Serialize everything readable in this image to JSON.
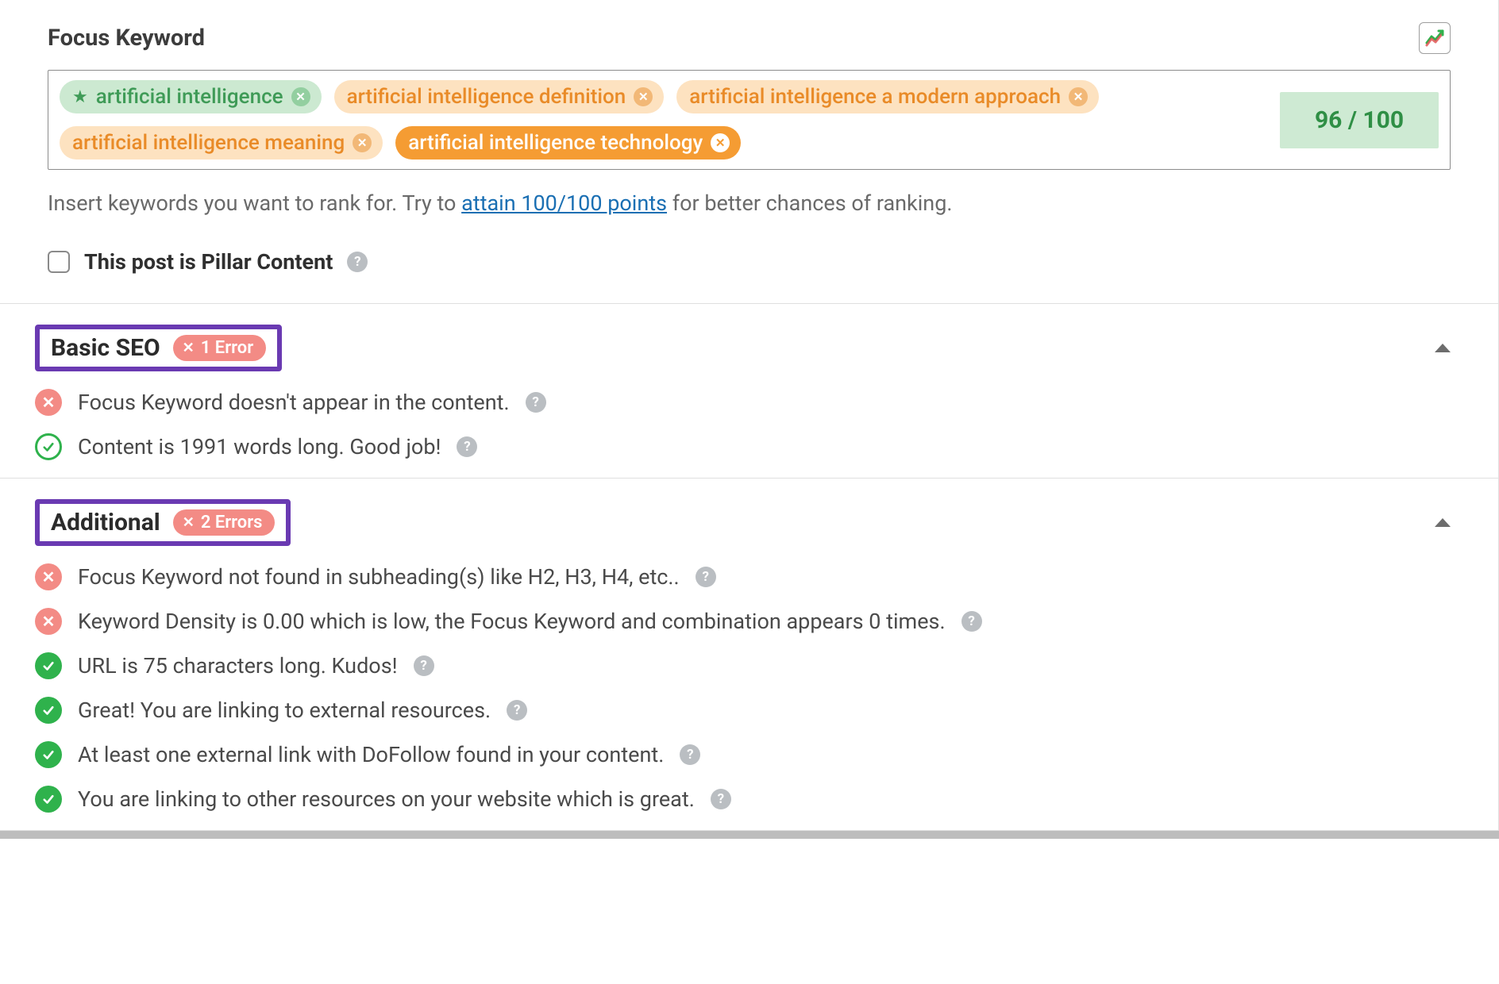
{
  "focus": {
    "heading": "Focus Keyword",
    "keywords": [
      {
        "label": "artificial intelligence",
        "variant": "primary"
      },
      {
        "label": "artificial intelligence definition",
        "variant": "soft"
      },
      {
        "label": "artificial intelligence a modern approach",
        "variant": "soft"
      },
      {
        "label": "artificial intelligence meaning",
        "variant": "soft"
      },
      {
        "label": "artificial intelligence technology",
        "variant": "solid"
      }
    ],
    "score_text": "96 / 100",
    "hint_prefix": "Insert keywords you want to rank for. Try to ",
    "hint_link": "attain 100/100 points",
    "hint_suffix": " for better chances of ranking.",
    "pillar_label": "This post is Pillar Content"
  },
  "sections": [
    {
      "title": "Basic SEO",
      "error_badge": "1 Error",
      "items": [
        {
          "status": "error",
          "text": "Focus Keyword doesn't appear in the content."
        },
        {
          "status": "ok-ring",
          "text": "Content is 1991 words long. Good job!"
        }
      ]
    },
    {
      "title": "Additional",
      "error_badge": "2 Errors",
      "items": [
        {
          "status": "error",
          "text": "Focus Keyword not found in subheading(s) like H2, H3, H4, etc.."
        },
        {
          "status": "error",
          "text": "Keyword Density is 0.00 which is low, the Focus Keyword and combination appears 0 times."
        },
        {
          "status": "ok",
          "text": "URL is 75 characters long. Kudos!"
        },
        {
          "status": "ok",
          "text": "Great! You are linking to external resources."
        },
        {
          "status": "ok",
          "text": "At least one external link with DoFollow found in your content."
        },
        {
          "status": "ok",
          "text": "You are linking to other resources on your website which is great."
        }
      ]
    }
  ]
}
